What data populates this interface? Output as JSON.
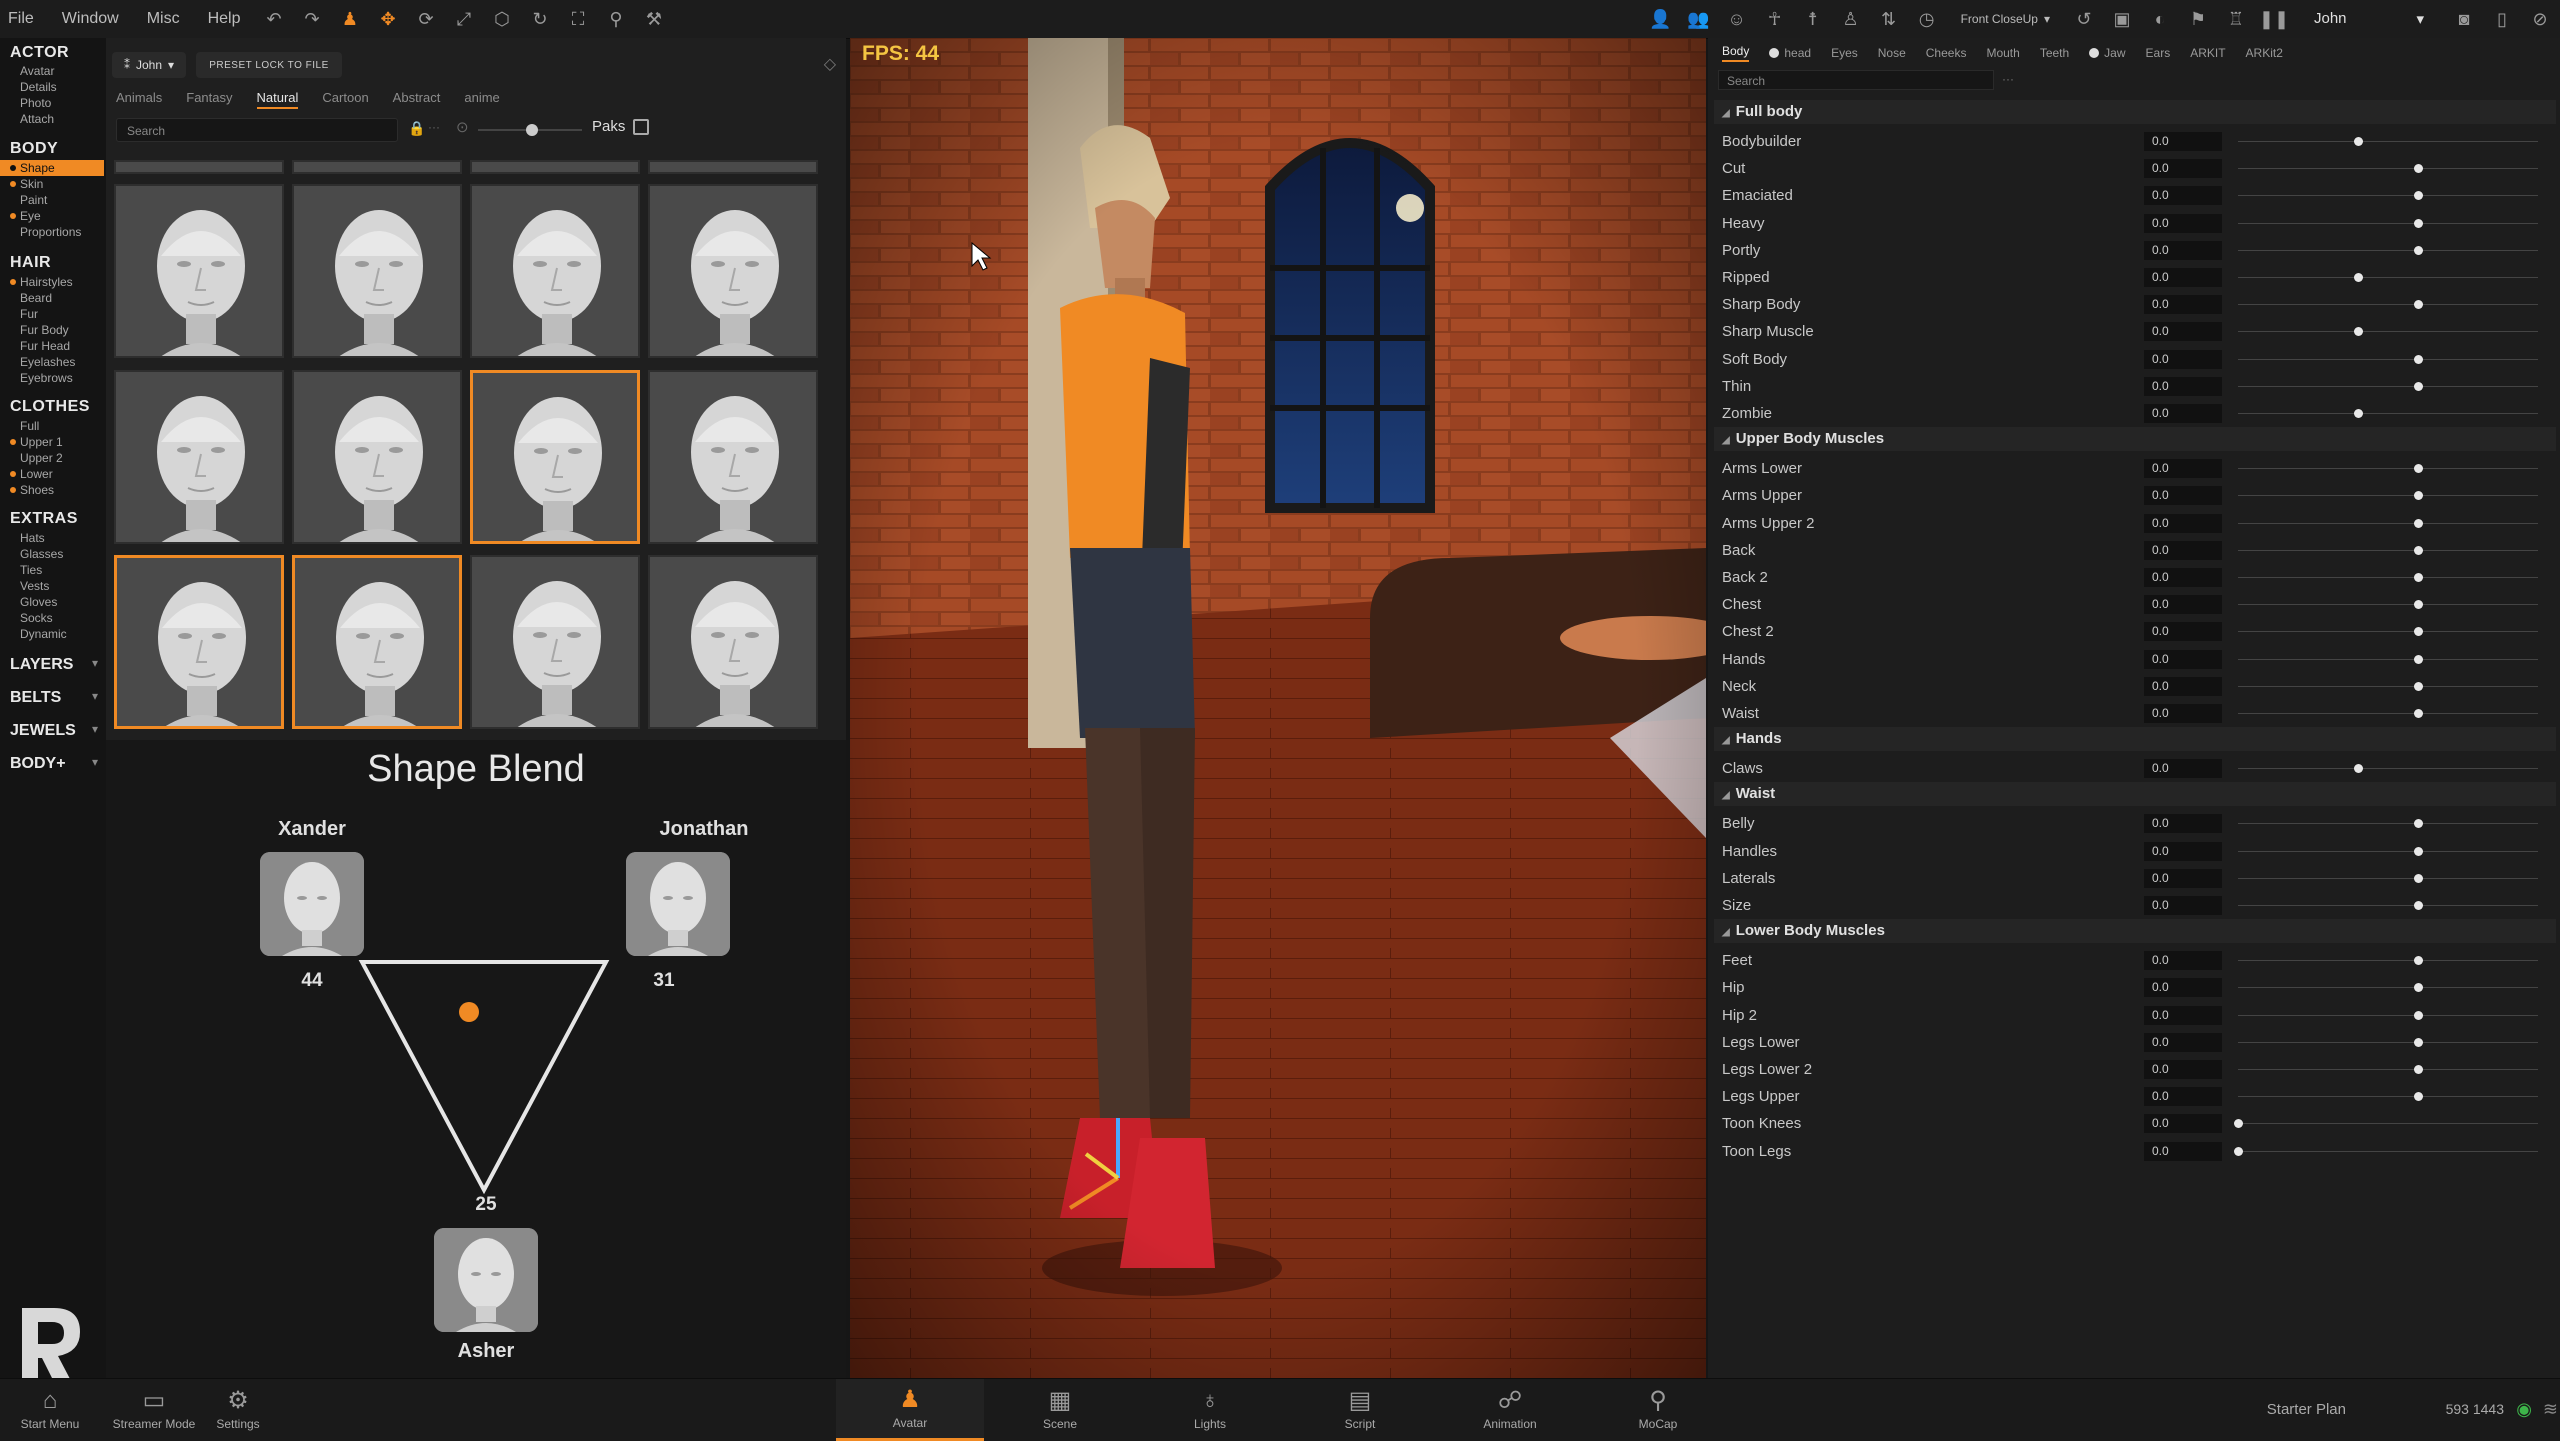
{
  "menu": [
    "File",
    "Window",
    "Misc",
    "Help"
  ],
  "camera_select": "Front CloseUp",
  "user_select": "John",
  "nav": {
    "actor": {
      "title": "ACTOR",
      "items": [
        "Avatar",
        "Details",
        "Photo",
        "Attach"
      ]
    },
    "body": {
      "title": "BODY",
      "items": [
        "Shape",
        "Skin",
        "Paint",
        "Eye",
        "Proportions"
      ],
      "active": "Shape"
    },
    "hair": {
      "title": "HAIR",
      "items": [
        "Hairstyles",
        "Beard",
        "Fur",
        "Fur Body",
        "Fur Head",
        "Eyelashes",
        "Eyebrows"
      ]
    },
    "clothes": {
      "title": "CLOTHES",
      "items": [
        "Full",
        "Upper 1",
        "Upper 2",
        "Lower",
        "Shoes"
      ]
    },
    "extras": {
      "title": "EXTRAS",
      "items": [
        "Hats",
        "Glasses",
        "Ties",
        "Vests",
        "Gloves",
        "Socks",
        "Dynamic"
      ]
    },
    "layers": "LAYERS",
    "belts": "BELTS",
    "jewels": "JEWELS",
    "bodyplus": "BODY+"
  },
  "asset_panel": {
    "actor_name": "John",
    "preset_button": "PRESET LOCK TO FILE",
    "tabs": [
      "Animals",
      "Fantasy",
      "Natural",
      "Cartoon",
      "Abstract",
      "anime"
    ],
    "active_tab": "Natural",
    "search_placeholder": "Search",
    "paks_label": "Paks"
  },
  "shape_blend": {
    "title": "Shape Blend",
    "a_name": "Xander",
    "a_value": "44",
    "b_name": "Jonathan",
    "b_value": "31",
    "c_name": "Asher",
    "c_value": "25"
  },
  "viewport": {
    "fps": "FPS: 44"
  },
  "props": {
    "tabs": [
      "Body",
      "head",
      "Eyes",
      "Nose",
      "Cheeks",
      "Mouth",
      "Teeth",
      "Jaw",
      "Ears",
      "ARKIT",
      "ARKit2"
    ],
    "active_tab": "Body",
    "search_placeholder": "Search",
    "more": "···",
    "sections": [
      {
        "title": "Full body",
        "rows": [
          {
            "label": "Bodybuilder",
            "value": "0.0",
            "slider": 0.4
          },
          {
            "label": "Cut",
            "value": "0.0",
            "slider": 0.6
          },
          {
            "label": "Emaciated",
            "value": "0.0",
            "slider": 0.6
          },
          {
            "label": "Heavy",
            "value": "0.0",
            "slider": 0.6
          },
          {
            "label": "Portly",
            "value": "0.0",
            "slider": 0.6
          },
          {
            "label": "Ripped",
            "value": "0.0",
            "slider": 0.4
          },
          {
            "label": "Sharp Body",
            "value": "0.0",
            "slider": 0.6
          },
          {
            "label": "Sharp Muscle",
            "value": "0.0",
            "slider": 0.4
          },
          {
            "label": "Soft Body",
            "value": "0.0",
            "slider": 0.6
          },
          {
            "label": "Thin",
            "value": "0.0",
            "slider": 0.6
          },
          {
            "label": "Zombie",
            "value": "0.0",
            "slider": 0.4
          }
        ]
      },
      {
        "title": "Upper Body Muscles",
        "rows": [
          {
            "label": "Arms Lower",
            "value": "0.0",
            "slider": 0.6
          },
          {
            "label": "Arms Upper",
            "value": "0.0",
            "slider": 0.6
          },
          {
            "label": "Arms Upper 2",
            "value": "0.0",
            "slider": 0.6
          },
          {
            "label": "Back",
            "value": "0.0",
            "slider": 0.6
          },
          {
            "label": "Back 2",
            "value": "0.0",
            "slider": 0.6
          },
          {
            "label": "Chest",
            "value": "0.0",
            "slider": 0.6
          },
          {
            "label": "Chest 2",
            "value": "0.0",
            "slider": 0.6
          },
          {
            "label": "Hands",
            "value": "0.0",
            "slider": 0.6
          },
          {
            "label": "Neck",
            "value": "0.0",
            "slider": 0.6
          },
          {
            "label": "Waist",
            "value": "0.0",
            "slider": 0.6
          }
        ]
      },
      {
        "title": "Hands",
        "rows": [
          {
            "label": "Claws",
            "value": "0.0",
            "slider": 0.4
          }
        ]
      },
      {
        "title": "Waist",
        "rows": [
          {
            "label": "Belly",
            "value": "0.0",
            "slider": 0.6
          },
          {
            "label": "Handles",
            "value": "0.0",
            "slider": 0.6
          },
          {
            "label": "Laterals",
            "value": "0.0",
            "slider": 0.6
          },
          {
            "label": "Size",
            "value": "0.0",
            "slider": 0.6
          }
        ]
      },
      {
        "title": "Lower Body Muscles",
        "rows": [
          {
            "label": "Feet",
            "value": "0.0",
            "slider": 0.6
          },
          {
            "label": "Hip",
            "value": "0.0",
            "slider": 0.6
          },
          {
            "label": "Hip 2",
            "value": "0.0",
            "slider": 0.6
          },
          {
            "label": "Legs Lower",
            "value": "0.0",
            "slider": 0.6
          },
          {
            "label": "Legs Lower 2",
            "value": "0.0",
            "slider": 0.6
          },
          {
            "label": "Legs Upper",
            "value": "0.0",
            "slider": 0.6
          },
          {
            "label": "Toon Knees",
            "value": "0.0",
            "slider": 0.0
          },
          {
            "label": "Toon Legs",
            "value": "0.0",
            "slider": 0.0
          }
        ]
      }
    ]
  },
  "bottom": {
    "left": [
      {
        "label": "Start Menu",
        "icon": "home-icon"
      },
      {
        "label": "Streamer Mode",
        "icon": "monitor-icon"
      },
      {
        "label": "Settings",
        "icon": "gear-icon"
      }
    ],
    "center": [
      {
        "label": "Avatar",
        "icon": "avatar-icon"
      },
      {
        "label": "Scene",
        "icon": "scene-icon"
      },
      {
        "label": "Lights",
        "icon": "light-icon"
      },
      {
        "label": "Script",
        "icon": "script-icon"
      },
      {
        "label": "Animation",
        "icon": "animation-icon"
      },
      {
        "label": "MoCap",
        "icon": "mocap-icon"
      }
    ],
    "active": "Avatar",
    "plan": "Starter Plan",
    "coords": "593 1443"
  },
  "colors": {
    "accent": "#f08a24",
    "fps": "#f4c542",
    "status_ok": "#3db54a"
  }
}
